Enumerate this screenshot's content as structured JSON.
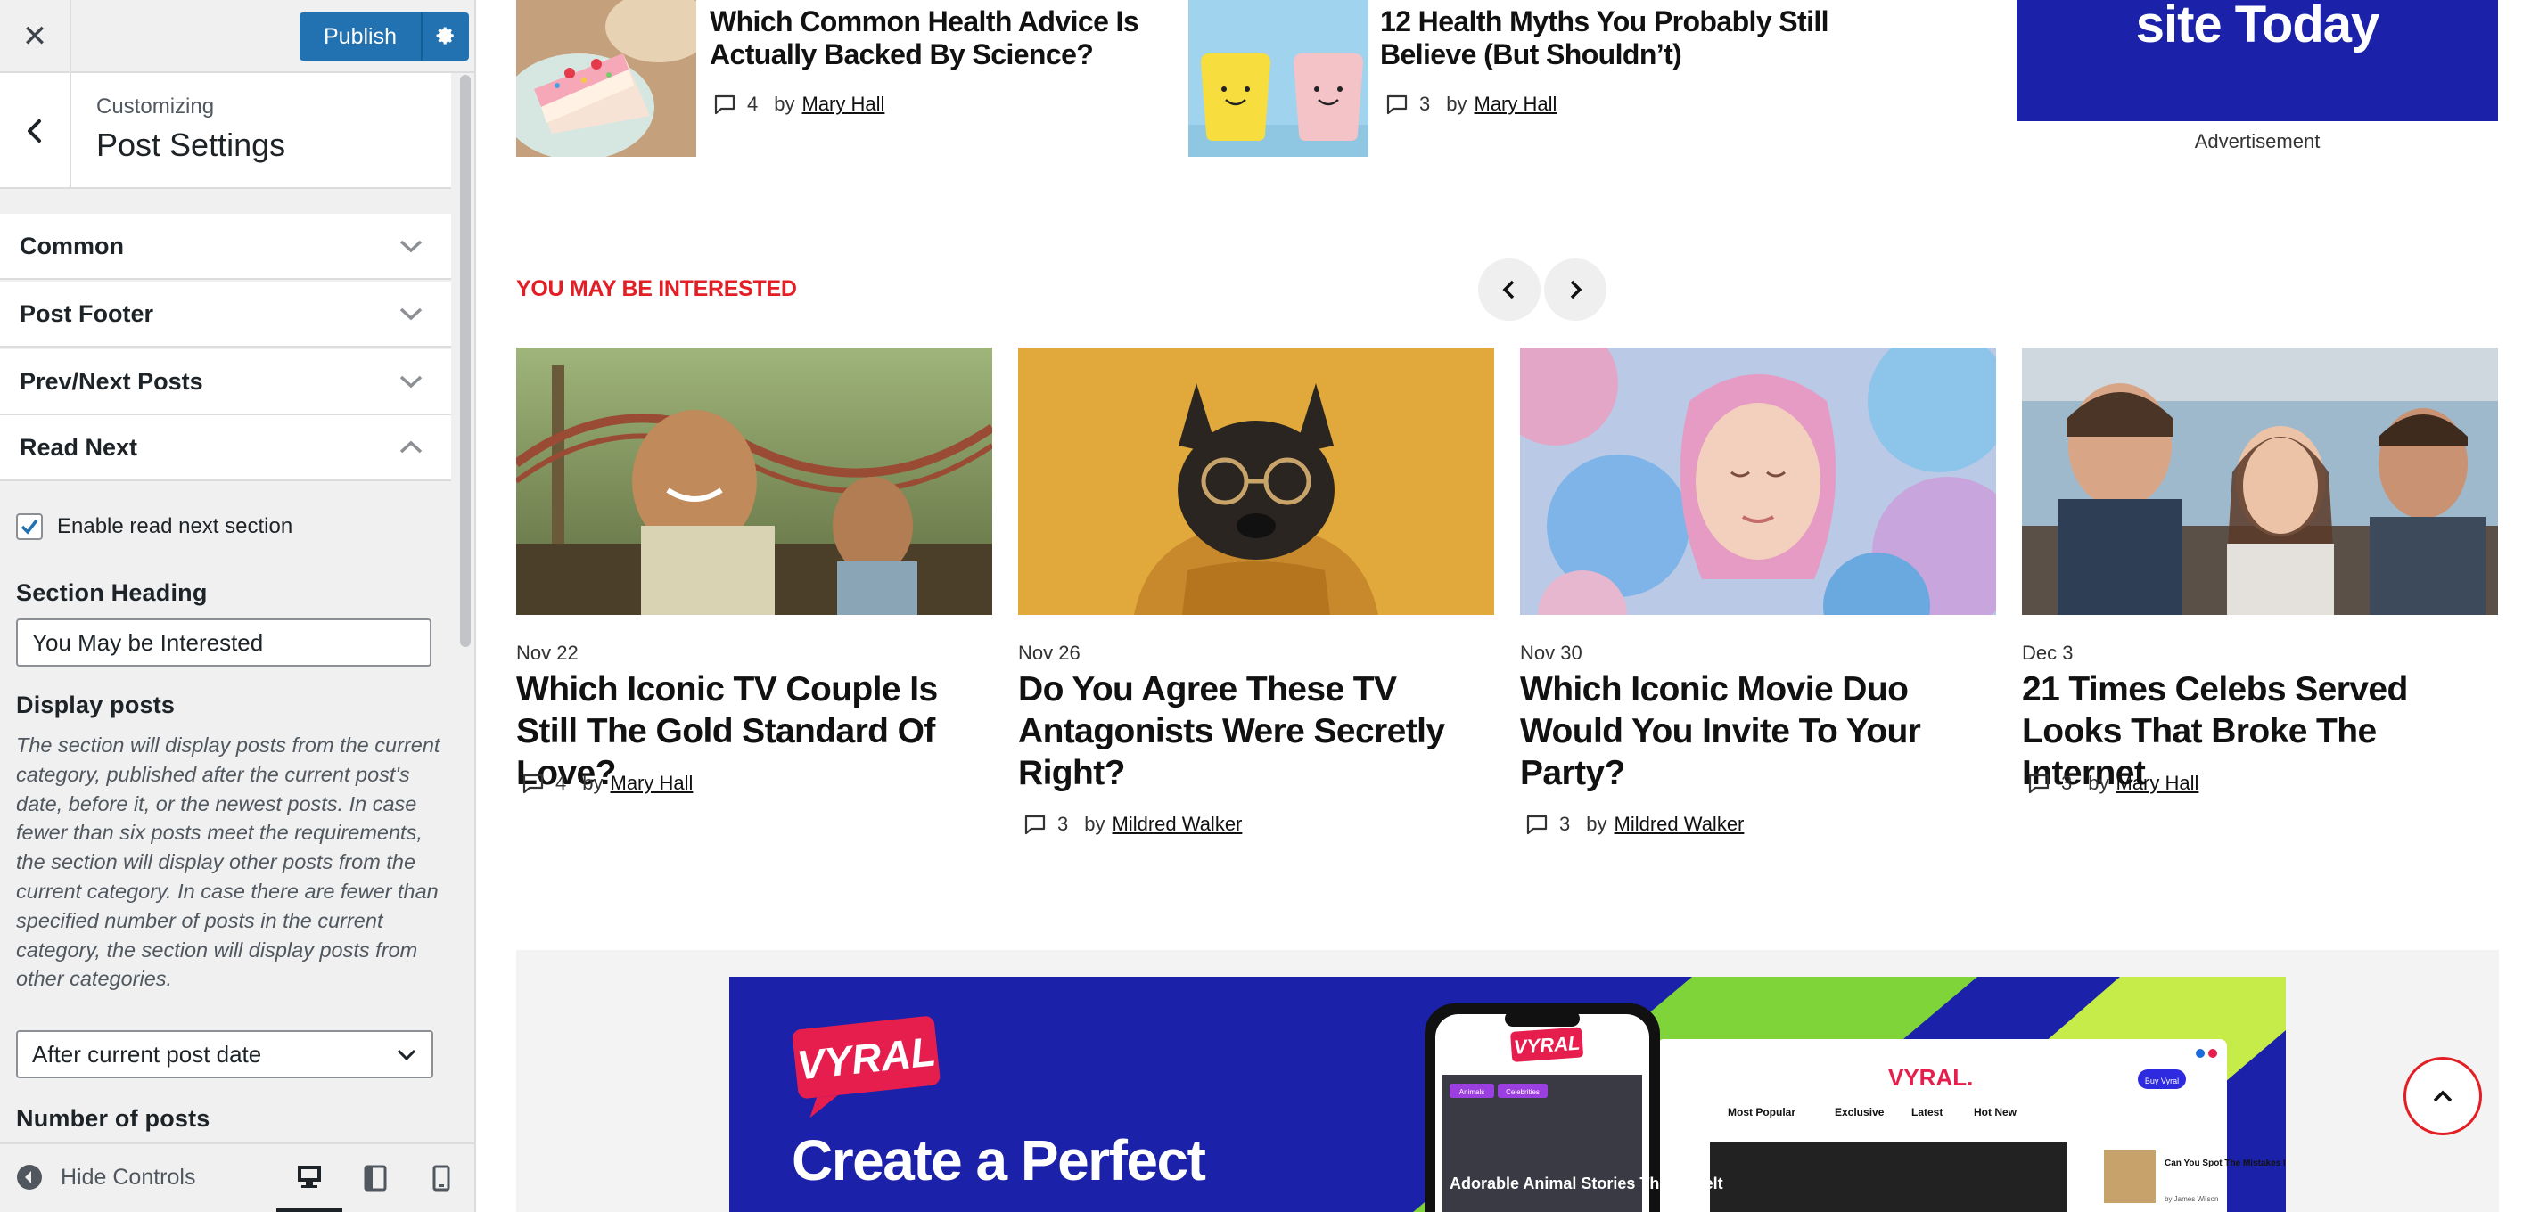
{
  "customizer": {
    "publish_label": "Publish",
    "customizing_label": "Customizing",
    "section_title": "Post Settings",
    "accordion": [
      {
        "label": "Common",
        "expanded": false
      },
      {
        "label": "Post Footer",
        "expanded": false
      },
      {
        "label": "Prev/Next Posts",
        "expanded": false
      },
      {
        "label": "Read Next",
        "expanded": true
      }
    ],
    "enable_label": "Enable read next section",
    "enable_checked": true,
    "section_heading_title": "Section Heading",
    "section_heading_value": "You May be Interested",
    "display_posts_title": "Display posts",
    "display_posts_description": "The section will display posts from the current category, published after the current post's date, before it, or the newest posts. In case fewer than six posts meet the requirements, the section will display other posts from the current category. In case there are fewer than specified number of posts in the current category, the section will display posts from other categories.",
    "display_posts_selected": "After current post date",
    "number_of_posts_title": "Number of posts",
    "hide_controls_label": "Hide Controls",
    "accent": "#2271b1"
  },
  "preview": {
    "top_posts": [
      {
        "title": "Which Common Health Advice Is Actually Backed By Science?",
        "comments": "4",
        "by": "by",
        "author": "Mary Hall"
      },
      {
        "title": "12 Health Myths You Probably Still Believe (But Shouldn’t)",
        "comments": "3",
        "by": "by",
        "author": "Mary Hall"
      }
    ],
    "ad_text": "site Today",
    "ad_label": "Advertisement",
    "read_next_heading": "YOU MAY BE INTERESTED",
    "cards": [
      {
        "date": "Nov 22",
        "title": "Which Iconic TV Couple Is Still The Gold Standard Of Love?",
        "comments": "4",
        "by": "by",
        "author": "Mary Hall"
      },
      {
        "date": "Nov 26",
        "title": "Do You Agree These TV Antagonists Were Secretly Right?",
        "comments": "3",
        "by": "by",
        "author": "Mildred Walker"
      },
      {
        "date": "Nov 30",
        "title": "Which Iconic Movie Duo Would You Invite To Your Party?",
        "comments": "3",
        "by": "by",
        "author": "Mildred Walker"
      },
      {
        "date": "Dec 3",
        "title": "21 Times Celebs Served Looks That Broke The Internet",
        "comments": "3",
        "by": "by",
        "author": "Mary Hall"
      }
    ],
    "promo": {
      "logo": "VYRAL",
      "headline": "Create a Perfect",
      "phone_logo": "VYRAL",
      "phone_chip_1": "Animals",
      "phone_chip_2": "Celebrities",
      "phone_caption": "Adorable Animal Stories That'll Melt",
      "site_logo": "VYRAL.",
      "buy_label": "Buy Vyral",
      "nav": [
        "Most Popular",
        "Exclusive",
        "Latest",
        "Hot New"
      ],
      "article_title": "Can You Spot The Mistakes In These Famous Home Makeovers? Let's Try!",
      "article_meta": "by James Wilson"
    },
    "accent_red": "#e31e24",
    "banner_blue": "#1b21a8"
  }
}
